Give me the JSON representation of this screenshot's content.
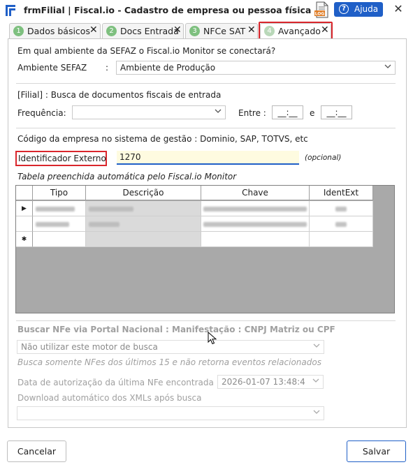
{
  "window": {
    "title": "frmFilial | Fiscal.io - Cadastro de empresa ou pessoa física",
    "help_label": "Ajuda",
    "log_icon_text": "LOG",
    "close_glyph": "✕"
  },
  "tabs": [
    {
      "num": "1",
      "label": "Dados básicos"
    },
    {
      "num": "2",
      "label": "Docs Entrada"
    },
    {
      "num": "3",
      "label": "NFCe SAT"
    },
    {
      "num": "4",
      "label": "Avançado"
    }
  ],
  "tab_close_glyph": "✕",
  "sefaz": {
    "question": "Em qual ambiente da SEFAZ o Fiscal.io Monitor se conectará?",
    "label": "Ambiente SEFAZ",
    "colon": ":",
    "value": "Ambiente de Produção"
  },
  "filial": {
    "heading": "[Filial] : Busca de documentos fiscais de entrada",
    "frequency_label": "Frequência:",
    "frequency_value": "",
    "between_label": "Entre :",
    "time_from": "__:__",
    "and_label": "e",
    "time_to": "__:__"
  },
  "identifier": {
    "heading": "Código da empresa no sistema de gestão : Dominio, SAP, TOTVS, etc",
    "label": "Identificador Externo",
    "value": "1270",
    "optional_note": "(opcional)"
  },
  "table": {
    "caption": "Tabela preenchida automática pelo Fiscal.io Monitor",
    "columns": [
      "Tipo",
      "Descrição",
      "Chave",
      "IdentExt"
    ],
    "current_row_marker": "▶",
    "new_row_marker": "✱"
  },
  "nfe_portal": {
    "heading": "Buscar NFe via Portal Nacional : Manifestação : CNPJ Matriz ou CPF",
    "engine_value": "Não utilizar este motor de busca",
    "note": "Busca somente NFes dos últimos 15 e não retorna eventos relacionados",
    "last_auth_label": "Data de autorização da última NFe encontrada :",
    "last_auth_value": "2026-01-07 13:48:4",
    "auto_download_label": "Download automático dos XMLs após busca",
    "auto_download_value": ""
  },
  "footer": {
    "cancel_label": "Cancelar",
    "save_label": "Salvar"
  },
  "colors": {
    "accent": "#1f5fc7",
    "highlight_red": "#d9262c",
    "tab_number_green": "#7ec07f",
    "input_yellow": "#fefbe0"
  }
}
